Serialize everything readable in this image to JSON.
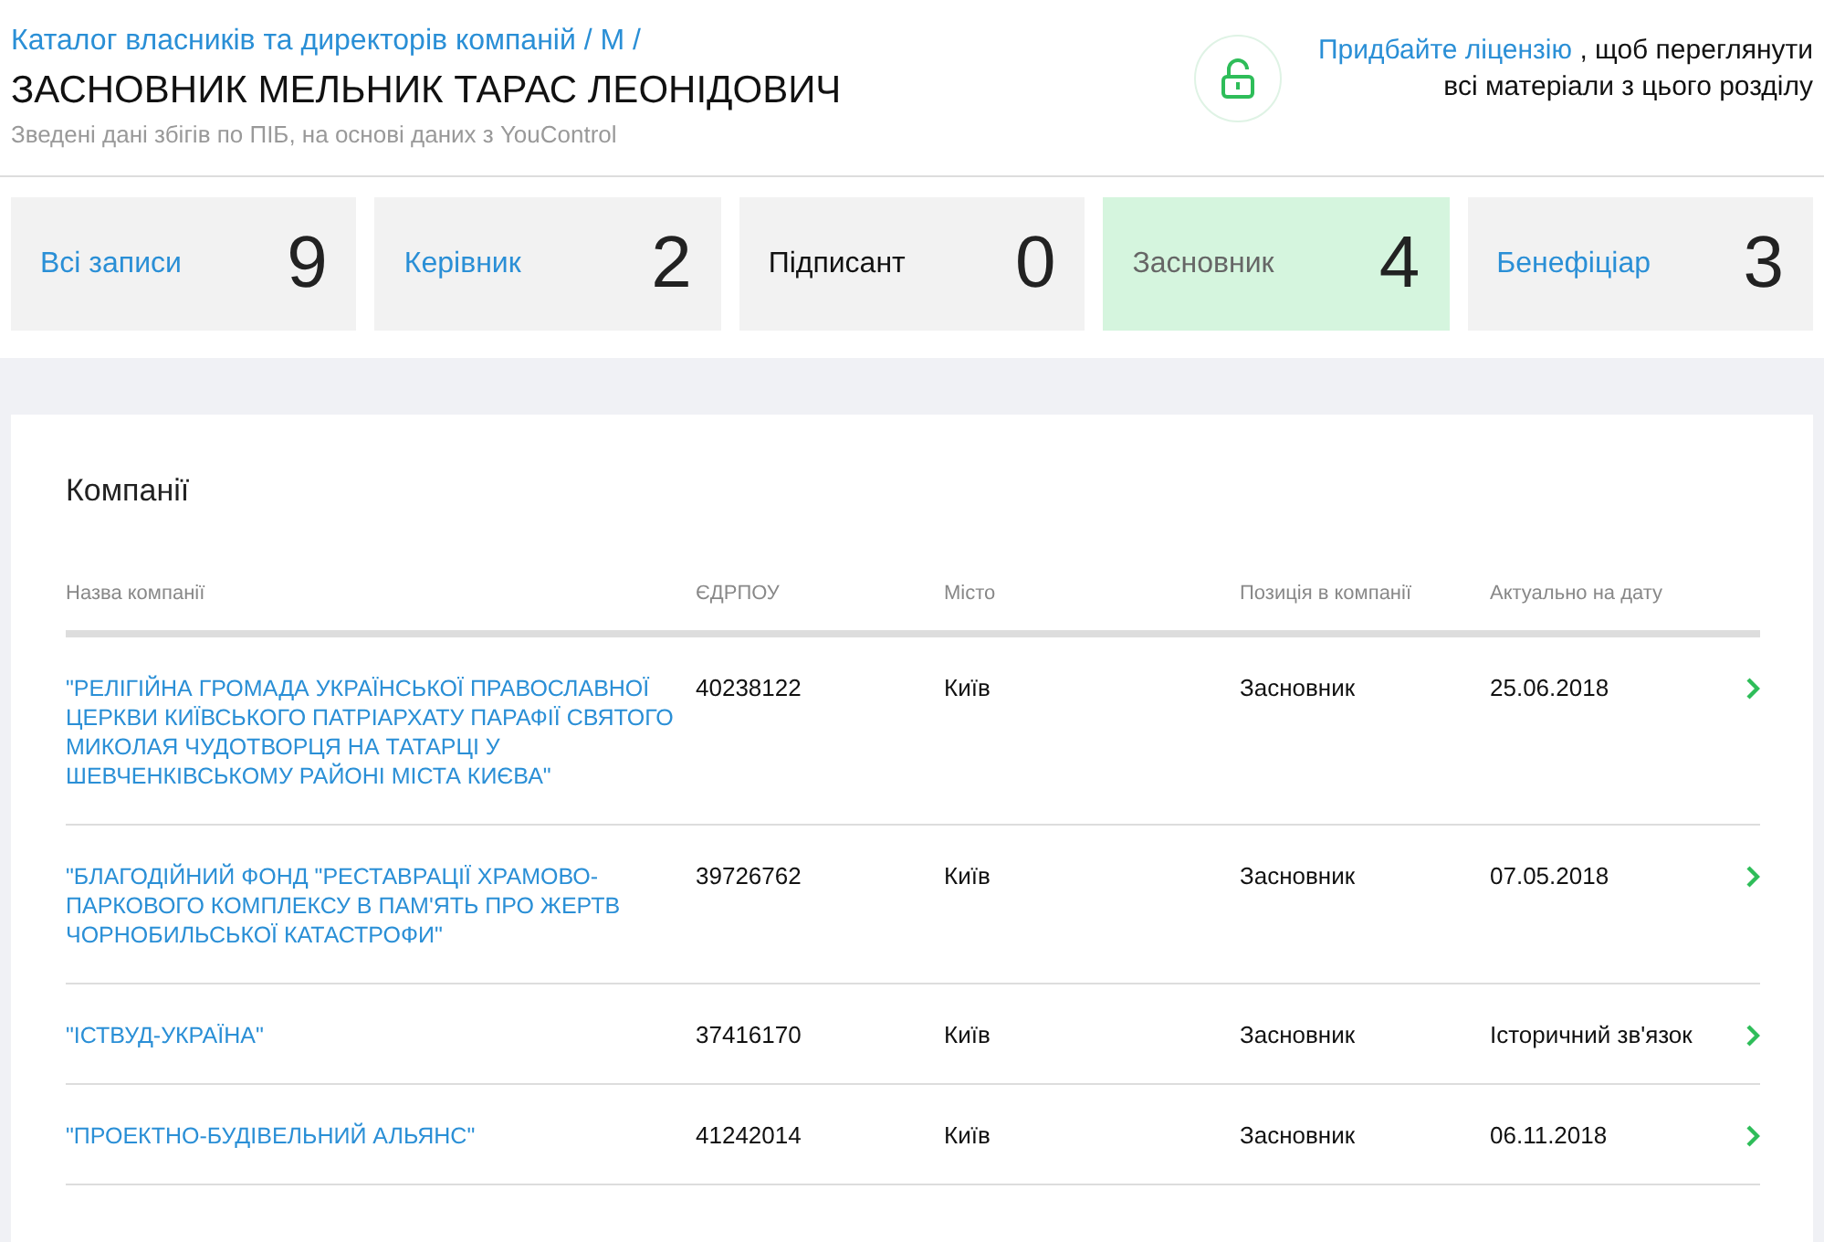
{
  "breadcrumb": "Каталог власників та директорів компаній / М /",
  "title": "ЗАСНОВНИК МЕЛЬНИК ТАРАС ЛЕОНІДОВИЧ",
  "subtitle": "Зведені дані збігів по ПІБ, на основі даних з YouControl",
  "license": {
    "link": "Придбайте ліцензію",
    "text_1": ", щоб переглянути",
    "text_2": "всі матеріали з цього розділу"
  },
  "filters": [
    {
      "label": "Всі записи",
      "count": "9",
      "selected": false,
      "disabled": false
    },
    {
      "label": "Керівник",
      "count": "2",
      "selected": false,
      "disabled": false
    },
    {
      "label": "Підписант",
      "count": "0",
      "selected": false,
      "disabled": true
    },
    {
      "label": "Засновник",
      "count": "4",
      "selected": true,
      "disabled": false
    },
    {
      "label": "Бенефіціар",
      "count": "3",
      "selected": false,
      "disabled": false
    }
  ],
  "panel": {
    "title": "Компанії",
    "table": {
      "columns": [
        "Назва компанії",
        "ЄДРПОУ",
        "Місто",
        "Позиція в компанії",
        "Актуально на дату"
      ],
      "rows": [
        {
          "name": "\"РЕЛІГІЙНА ГРОМАДА УКРАЇНСЬКОЇ ПРАВОСЛАВНОЇ ЦЕРКВИ КИЇВСЬКОГО ПАТРІАРХАТУ ПАРАФІЇ СВЯТОГО МИКОЛАЯ ЧУДОТВОРЦЯ НА ТАТАРЦІ У ШЕВЧЕНКІВСЬКОМУ РАЙОНІ МІСТА КИЄВА\"",
          "code": "40238122",
          "city": "Київ",
          "position": "Засновник",
          "date": "25.06.2018"
        },
        {
          "name": "\"БЛАГОДІЙНИЙ ФОНД \"РЕСТАВРАЦІЇ ХРАМОВО-ПАРКОВОГО КОМПЛЕКСУ В ПАМ'ЯТЬ ПРО ЖЕРТВ ЧОРНОБИЛЬСЬКОЇ КАТАСТРОФИ\"",
          "code": "39726762",
          "city": "Київ",
          "position": "Засновник",
          "date": "07.05.2018"
        },
        {
          "name": "\"ІСТВУД-УКРАЇНА\"",
          "code": "37416170",
          "city": "Київ",
          "position": "Засновник",
          "date": "Історичний зв'язок"
        },
        {
          "name": "\"ПРОЕКТНО-БУДІВЕЛЬНИЙ АЛЬЯНС\"",
          "code": "41242014",
          "city": "Київ",
          "position": "Засновник",
          "date": "06.11.2018"
        }
      ]
    }
  }
}
